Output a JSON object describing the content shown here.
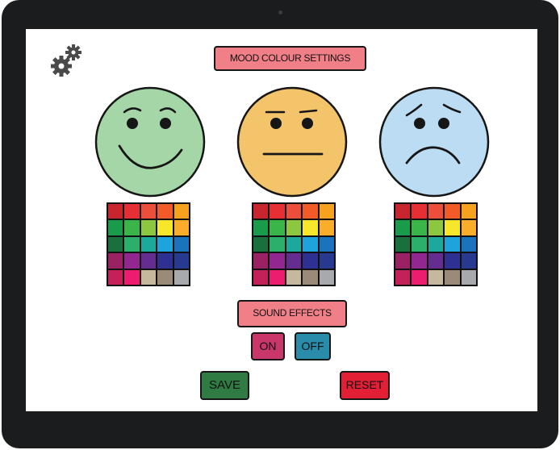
{
  "header": {
    "title": "MOOD COLOUR SETTINGS"
  },
  "icons": {
    "settings": "gears-icon"
  },
  "moods": [
    {
      "name": "happy",
      "face_color": "#a5d6a7"
    },
    {
      "name": "neutral",
      "face_color": "#f4c46b"
    },
    {
      "name": "sad",
      "face_color": "#bcdcf3"
    }
  ],
  "palette_colors": [
    "#c8252e",
    "#e52f35",
    "#eb4e3a",
    "#f15a29",
    "#f6a21e",
    "#1a9b4b",
    "#3ab54a",
    "#8dc63f",
    "#f6e72b",
    "#f9ad2a",
    "#1b6f3c",
    "#2baf6b",
    "#1aa99a",
    "#1fa3dc",
    "#1b74bb",
    "#9a2263",
    "#92278f",
    "#662d91",
    "#2e3192",
    "#283a8f",
    "#c4215b",
    "#ec1c6e",
    "#c6b89c",
    "#9a8a78",
    "#a7a9ac"
  ],
  "sound": {
    "label": "SOUND EFFECTS",
    "on_label": "ON",
    "off_label": "OFF"
  },
  "actions": {
    "save_label": "SAVE",
    "reset_label": "RESET"
  },
  "colors": {
    "accent_pink": "#f07f88",
    "save_green": "#2f7b43",
    "reset_red": "#e31f35",
    "on_magenta": "#c8366a",
    "off_teal": "#2a8cab"
  }
}
